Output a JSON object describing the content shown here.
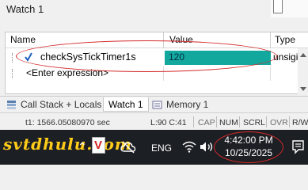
{
  "window": {
    "title": "Watch 1"
  },
  "grid": {
    "headers": {
      "name": "Name",
      "value": "Value",
      "type": "Type"
    },
    "rows": [
      {
        "name": "checkSysTickTimer1s",
        "value": "120",
        "type": "unsigi"
      }
    ],
    "placeholder": "<Enter expression>"
  },
  "tabs": {
    "call_stack": "Call Stack + Locals",
    "watch": "Watch 1",
    "memory": "Memory 1"
  },
  "status": {
    "time": "t1: 1566.05080970 sec",
    "position": "L:90 C:41",
    "cap": "CAP",
    "num": "NUM",
    "scrl": "SCRL",
    "ovr": "OVR",
    "rw": "R/W"
  },
  "taskbar": {
    "watermark": "svtdhulu.com",
    "language": "ENG",
    "time": "4:42:00 PM",
    "date": "10/25/2025"
  },
  "colors": {
    "value_highlight": "#13a89e",
    "annotation": "#d42a2a",
    "taskbar_bg": "#1c1f24",
    "watermark": "#ffcc1a"
  }
}
